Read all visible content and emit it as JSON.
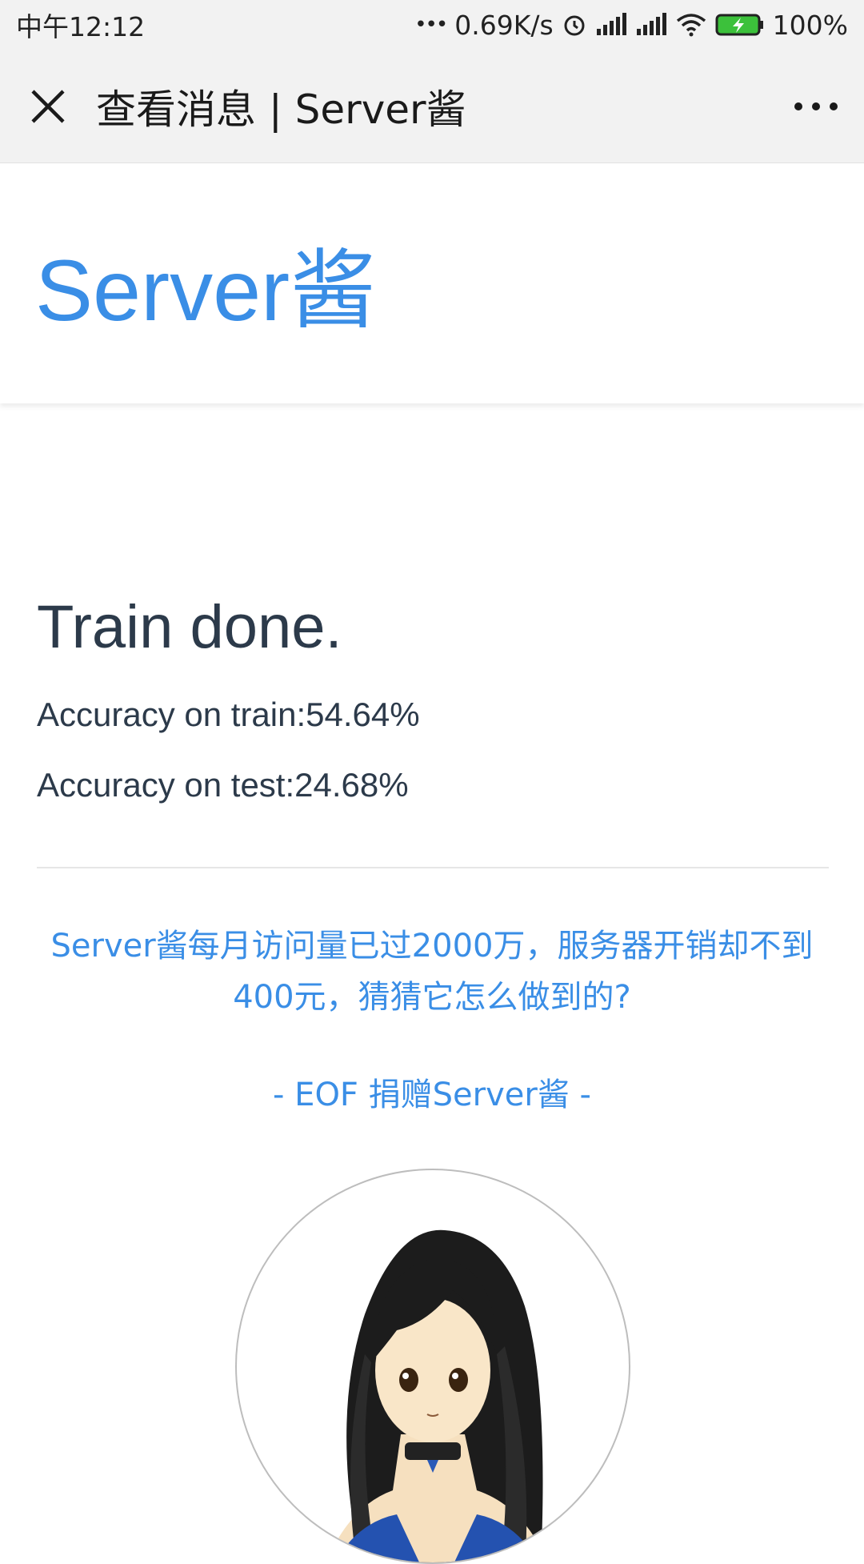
{
  "status_bar": {
    "time": "中午12:12",
    "dots": "•••",
    "speed": "0.69K/s",
    "battery": "100%",
    "icons": [
      "alarm-icon",
      "signal-icon",
      "signal-icon",
      "wifi-icon",
      "battery-icon"
    ]
  },
  "nav": {
    "title": "查看消息 | Server酱",
    "close_icon": "close-icon",
    "more_icon": "more-icon"
  },
  "header": {
    "brand": "Server酱",
    "brand_color": "#3a8ee6"
  },
  "message": {
    "title": "Train done.",
    "lines": [
      "Accuracy on train:54.64%",
      "Accuracy on test:24.68%"
    ]
  },
  "promo": {
    "text": "Server酱每月访问量已过2000万，服务器开销却不到400元，猜猜它怎么做到的?",
    "eof": "- EOF 捐赠Server酱 -"
  },
  "colors": {
    "accent": "#3a8ee6",
    "text": "#2c3a4a",
    "bar_bg": "#f2f2f2"
  }
}
